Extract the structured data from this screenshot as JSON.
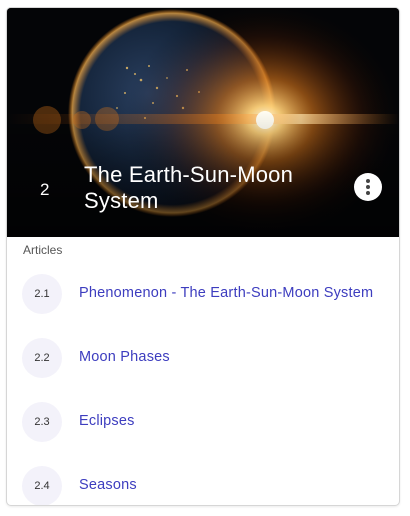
{
  "unit": {
    "number": "2",
    "title": "The Earth-Sun-Moon System"
  },
  "menu_icon": "vertical-dots-icon",
  "section": {
    "label": "Articles"
  },
  "articles": [
    {
      "number": "2.1",
      "title": "Phenomenon - The Earth-Sun-Moon System"
    },
    {
      "number": "2.2",
      "title": "Moon Phases"
    },
    {
      "number": "2.3",
      "title": "Eclipses"
    },
    {
      "number": "2.4",
      "title": "Seasons"
    }
  ],
  "colors": {
    "link": "#3d3dbf",
    "number_bubble": "#f3f2fa",
    "hero_background": "#050608"
  }
}
